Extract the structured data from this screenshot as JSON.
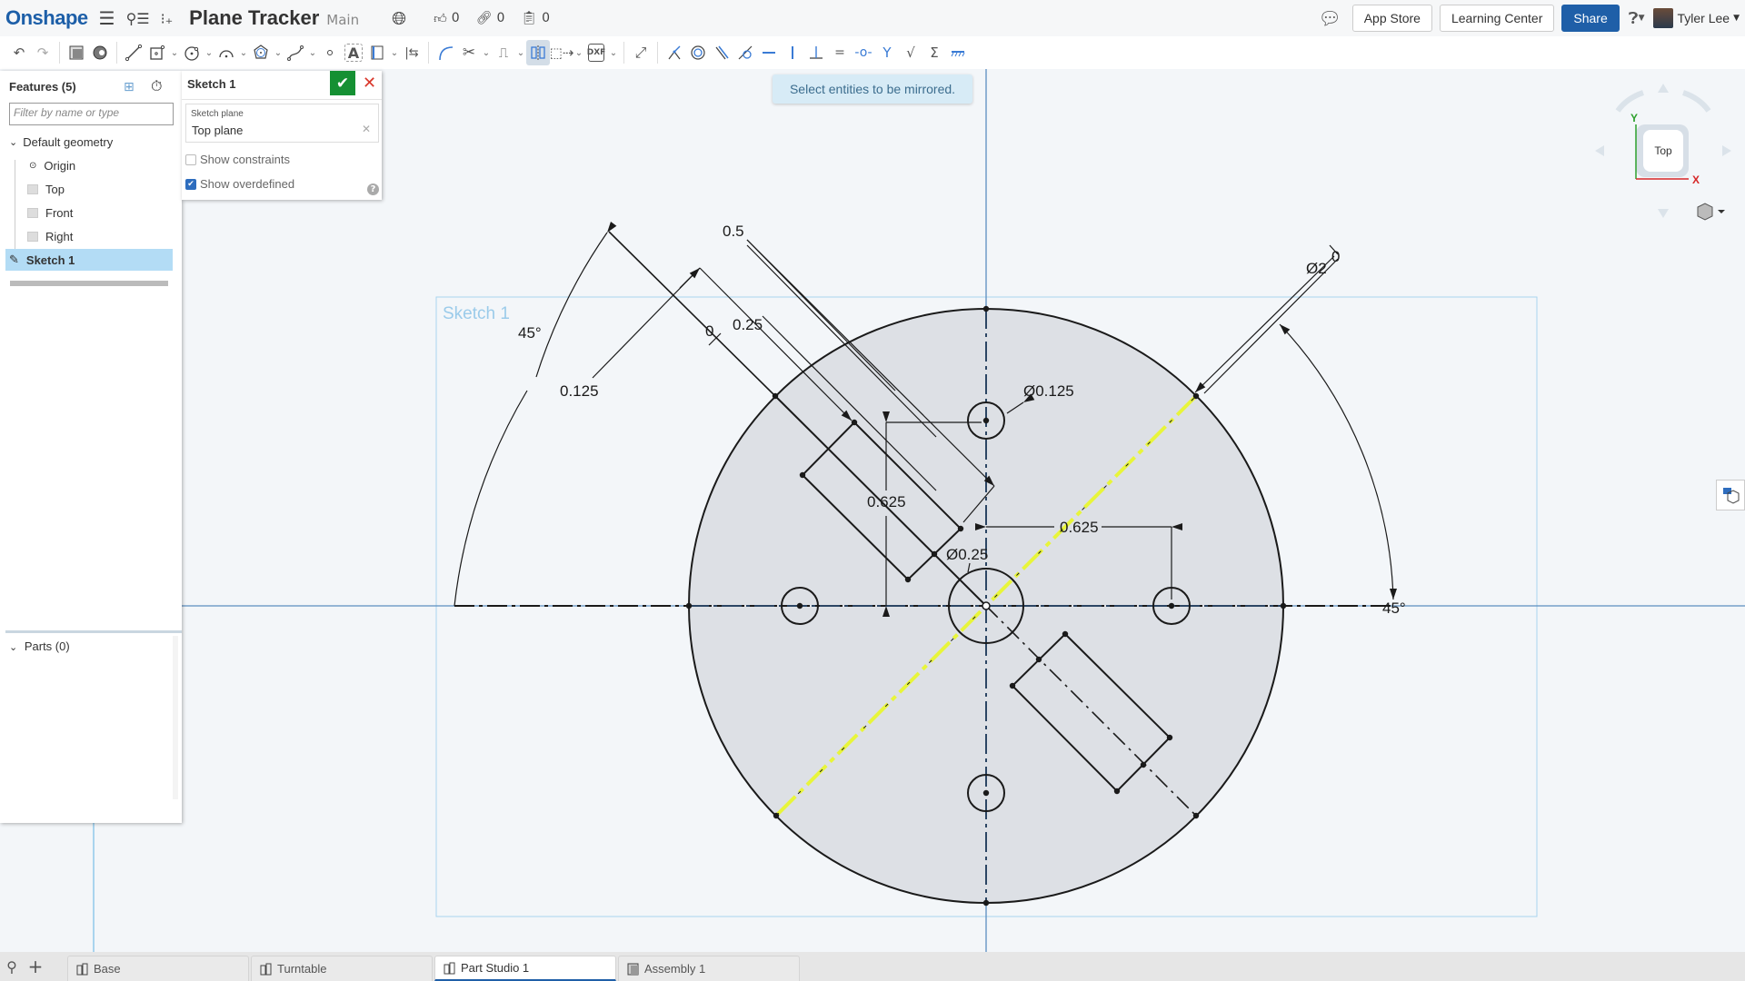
{
  "header": {
    "logo": "Onshape",
    "document_title": "Plane Tracker",
    "branch": "Main",
    "likes": "0",
    "links": "0",
    "copies": "0",
    "app_store": "App Store",
    "learning_center": "Learning Center",
    "share": "Share",
    "user_name": "Tyler Lee"
  },
  "toolbar": {
    "tools": [
      "undo",
      "redo",
      "feature-list",
      "configurations",
      "line",
      "rectangle",
      "circle",
      "arc",
      "polygon",
      "spline",
      "point",
      "text",
      "construction",
      "midpoint",
      "fillet",
      "trim",
      "offset",
      "mirror",
      "transform",
      "dxf-import",
      "dimension",
      "coincident",
      "concentric",
      "parallel",
      "tangent",
      "horizontal",
      "vertical",
      "perpendicular",
      "equal",
      "midpoint-constraint",
      "normal",
      "pierce",
      "symmetric",
      "fix"
    ],
    "active_tool": "mirror"
  },
  "features": {
    "title": "Features (5)",
    "filter_placeholder": "Filter by name or type",
    "default_geometry": "Default geometry",
    "items": [
      {
        "label": "Origin",
        "icon": "origin-icon"
      },
      {
        "label": "Top",
        "icon": "plane-icon"
      },
      {
        "label": "Front",
        "icon": "plane-icon"
      },
      {
        "label": "Right",
        "icon": "plane-icon"
      }
    ],
    "sketch": "Sketch 1",
    "parts": "Parts (0)"
  },
  "sketch_panel": {
    "title": "Sketch 1",
    "plane_label": "Sketch plane",
    "plane_value": "Top plane",
    "show_constraints": "Show constraints",
    "show_constraints_checked": false,
    "show_overdefined": "Show overdefined",
    "show_overdefined_checked": true
  },
  "toast": "Select entities to be mirrored.",
  "viewcube": {
    "face": "Top",
    "x_axis": "X",
    "y_axis": "Y"
  },
  "sketch": {
    "label": "Sketch 1",
    "dimensions": {
      "angle_left": "45°",
      "angle_right": "45°",
      "dist_0125": "0.125",
      "dist_05": "0.5",
      "dist_025": "0.25",
      "zero_left": "0",
      "zero_right": "0",
      "dia_small": "Ø0.125",
      "dia_center": "Ø0.25",
      "dia_outer": "Ø2",
      "vert_0625": "0.625",
      "horiz_0625": "0.625"
    }
  },
  "tabs": [
    {
      "label": "Base",
      "active": false
    },
    {
      "label": "Turntable",
      "active": false
    },
    {
      "label": "Part Studio 1",
      "active": true
    },
    {
      "label": "Assembly 1",
      "active": false
    }
  ],
  "colors": {
    "brand": "#1d5fa8",
    "confirm": "#159033",
    "cancel": "#d9372b",
    "mirror_line": "#e8f53a",
    "sketch_fill": "#dde0e5"
  }
}
